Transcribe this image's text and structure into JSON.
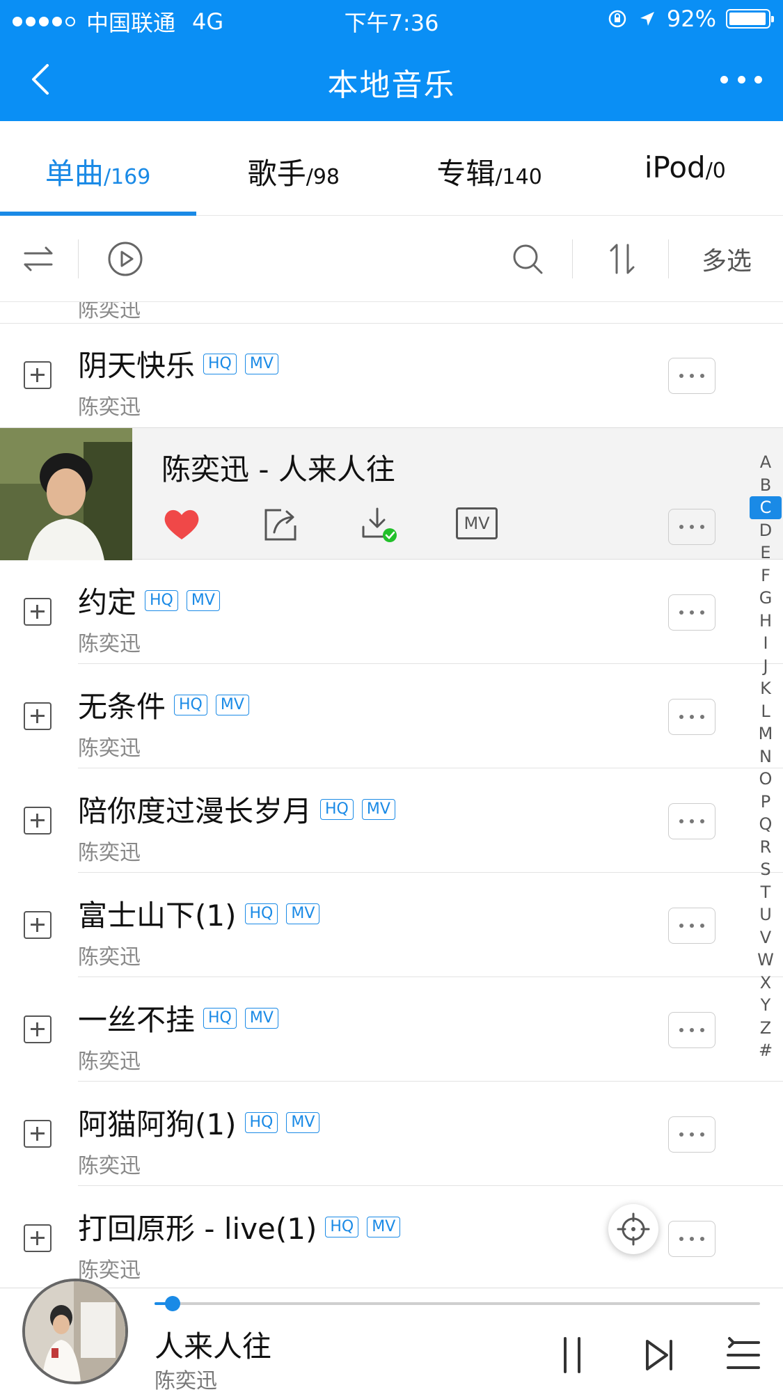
{
  "status_bar": {
    "carrier": "中国联通",
    "network": "4G",
    "time": "下午7:36",
    "battery": "92%"
  },
  "nav": {
    "title": "本地音乐"
  },
  "tabs": [
    {
      "label": "单曲",
      "count": "/169"
    },
    {
      "label": "歌手",
      "count": "/98"
    },
    {
      "label": "专辑",
      "count": "/140"
    },
    {
      "label": "iPod",
      "count": "/0"
    }
  ],
  "toolbar": {
    "multi_select": "多选"
  },
  "list": {
    "partial_artist": "陈奕迅",
    "badge_hq": "HQ",
    "badge_mv": "MV",
    "songs": [
      {
        "title": "阴天快乐",
        "artist": "陈奕迅"
      },
      {
        "title": "约定",
        "artist": "陈奕迅"
      },
      {
        "title": "无条件",
        "artist": "陈奕迅"
      },
      {
        "title": "陪你度过漫长岁月",
        "artist": "陈奕迅"
      },
      {
        "title": "富士山下(1)",
        "artist": "陈奕迅"
      },
      {
        "title": "一丝不挂",
        "artist": "陈奕迅"
      },
      {
        "title": "阿猫阿狗(1)",
        "artist": "陈奕迅"
      },
      {
        "title": "打回原形 - live(1)",
        "artist": "陈奕迅"
      }
    ],
    "expanded": {
      "title": "陈奕迅 - 人来人往",
      "mv_label": "MV"
    }
  },
  "index_letters": [
    "A",
    "B",
    "C",
    "D",
    "E",
    "F",
    "G",
    "H",
    "I",
    "J",
    "K",
    "L",
    "M",
    "N",
    "O",
    "P",
    "Q",
    "R",
    "S",
    "T",
    "U",
    "V",
    "W",
    "X",
    "Y",
    "Z",
    "#"
  ],
  "index_active": "C",
  "player": {
    "song": "人来人往",
    "artist": "陈奕迅",
    "progress": 0.03
  },
  "colors": {
    "brand": "#0a8ff5",
    "accent": "#1a8ae6",
    "heart": "#f04848",
    "download_ok": "#22c02a"
  }
}
